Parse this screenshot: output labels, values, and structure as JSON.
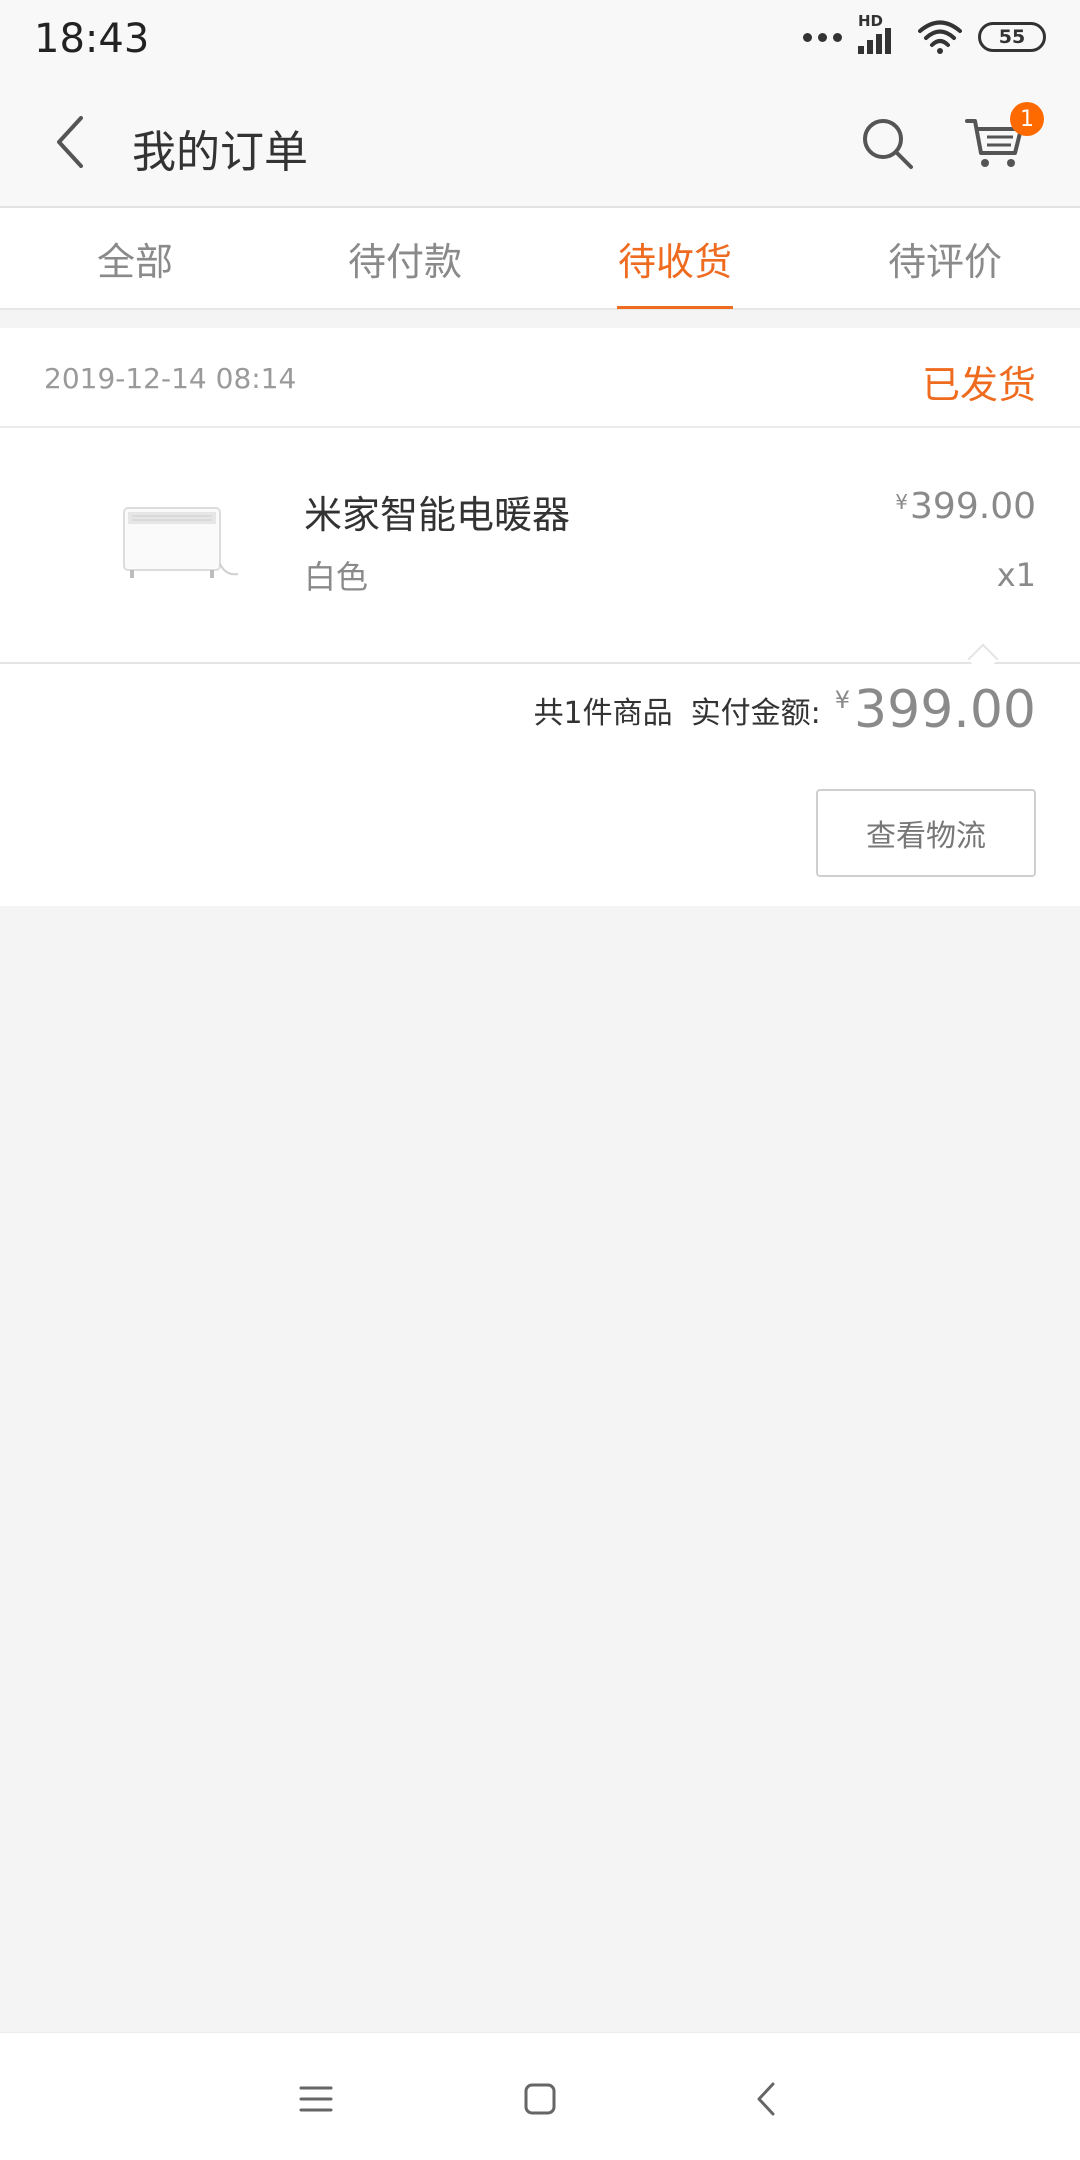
{
  "status_bar": {
    "time": "18:43",
    "network_label": "HD",
    "battery": "55",
    "icons": [
      "more-dots-icon",
      "cellular-signal-icon",
      "wifi-icon",
      "battery-icon"
    ]
  },
  "header": {
    "title": "我的订单",
    "cart_badge": "1",
    "icons": [
      "back-arrow-icon",
      "search-icon",
      "cart-icon"
    ]
  },
  "tabs": [
    {
      "label": "全部"
    },
    {
      "label": "待付款"
    },
    {
      "label": "待收货"
    },
    {
      "label": "待评价"
    }
  ],
  "active_tab": "待收货",
  "order": {
    "date": "2019-12-14 08:14",
    "status": "已发货",
    "product": {
      "name": "米家智能电暖器",
      "spec": "白色",
      "currency": "¥",
      "price": "399.00",
      "quantity": "x1"
    },
    "summary": {
      "count_text": "共1件商品",
      "paid_label": "实付金额:",
      "currency": "¥",
      "total": "399.00"
    },
    "logistics_button": "查看物流"
  },
  "colors": {
    "accent": "#ee6b1f",
    "badge": "#ff6a00",
    "background": "#f4f4f4"
  },
  "nav_bar": {
    "icons": [
      "menu-icon",
      "home-icon",
      "back-icon"
    ]
  }
}
